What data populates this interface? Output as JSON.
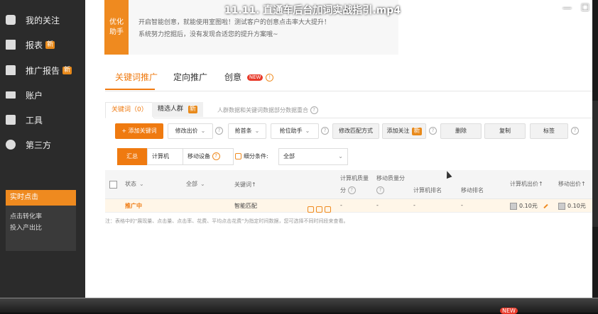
{
  "video": {
    "title": "11.11. 直通车后台加词实战指引.mp4",
    "min": "—",
    "close": "☐"
  },
  "sidebar": {
    "items": [
      {
        "label": "我的关注",
        "icon": "heart-icon"
      },
      {
        "label": "报表",
        "icon": "report-icon",
        "badge": "新"
      },
      {
        "label": "推广报告",
        "icon": "bag-icon",
        "badge": "新"
      },
      {
        "label": "账户",
        "icon": "card-icon"
      },
      {
        "label": "工具",
        "icon": "toolbox-icon"
      },
      {
        "label": "第三方",
        "icon": "cloud-icon"
      }
    ],
    "realtime": {
      "title": "实时点击",
      "rows": [
        "点击转化率",
        "投入产出比"
      ]
    }
  },
  "optimize": {
    "tag_line1": "优化",
    "tag_line2": "助手",
    "line1": "开启智能创意，就能使用室图啦！测试客户的创意点击率大大提升！",
    "line2": "系统努力挖掘后，没有发现合适您的提升方案哦~"
  },
  "tabs": {
    "items": [
      "关键词推广",
      "定向推广",
      "创意"
    ],
    "creative_badge": "NEW",
    "creative_icon": "!"
  },
  "subtabs": {
    "keywords": "关键词（0）",
    "crowd": "精选人群",
    "crowd_badge": "新",
    "note": "人群数据和关键词数据部分数据重合",
    "note_icon": "?"
  },
  "toolbar": {
    "add_keyword": "+ 添加关键词",
    "modify_bid": "修改出价",
    "rank_bid": "抢首条",
    "position_helper": "抢位助手",
    "modify_match": "修改匹配方式",
    "add_follow": "添加关注",
    "follow_badge": "新",
    "delete": "删除",
    "copy": "复制",
    "tag": "标签"
  },
  "filter": {
    "summary": "汇总",
    "computer": "计算机",
    "mobile": "移动设备",
    "segment_label": "细分条件:",
    "segment_value": "全部"
  },
  "table": {
    "headers": {
      "status": "状态",
      "all": "全部",
      "keyword": "关键词↑",
      "computer_quality_line1": "计算机质量",
      "computer_quality_line2": "分",
      "mobile_quality": "移动质量分",
      "computer_rank": "计算机排名",
      "mobile_rank": "移动排名",
      "computer_bid": "计算机出价↑",
      "mobile_bid": "移动出价↑"
    },
    "rows": [
      {
        "status": "推广中",
        "keyword": "智能匹配",
        "computer_quality": "-",
        "mobile_quality": "-",
        "computer_rank": "-",
        "mobile_rank": "-",
        "computer_bid": "0.10元",
        "mobile_bid": "0.10元"
      }
    ]
  },
  "footnote": "注：表格中的\"展现量、点击量、点击率、花费、平均点击花费\"为指定时间数据，您可选择不同时间段来查看。",
  "bottom": {
    "new_badge": "NEW"
  }
}
